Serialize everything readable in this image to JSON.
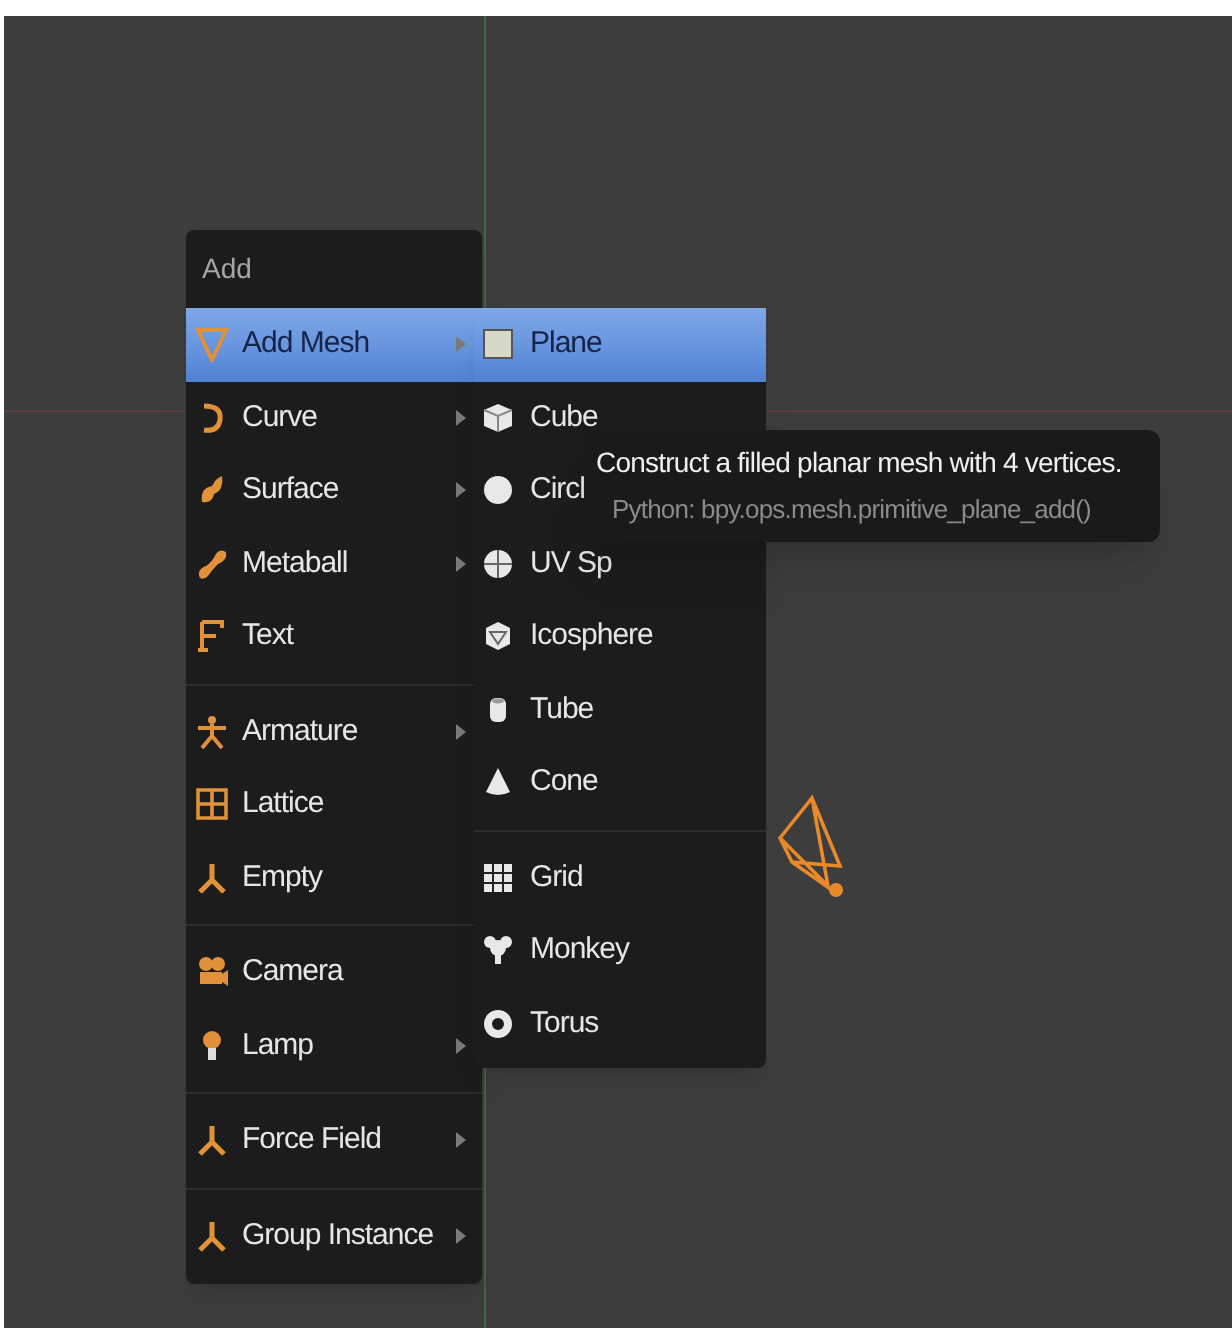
{
  "menu": {
    "title": "Add",
    "sections": [
      [
        {
          "label": "Add Mesh",
          "has_submenu": true,
          "selected": true
        },
        {
          "label": "Curve",
          "has_submenu": true,
          "selected": false
        },
        {
          "label": "Surface",
          "has_submenu": true,
          "selected": false
        },
        {
          "label": "Metaball",
          "has_submenu": true,
          "selected": false
        },
        {
          "label": "Text",
          "has_submenu": false,
          "selected": false
        }
      ],
      [
        {
          "label": "Armature",
          "has_submenu": true,
          "selected": false
        },
        {
          "label": "Lattice",
          "has_submenu": false,
          "selected": false
        },
        {
          "label": "Empty",
          "has_submenu": false,
          "selected": false
        }
      ],
      [
        {
          "label": "Camera",
          "has_submenu": false,
          "selected": false
        },
        {
          "label": "Lamp",
          "has_submenu": true,
          "selected": false
        }
      ],
      [
        {
          "label": "Force Field",
          "has_submenu": true,
          "selected": false
        }
      ],
      [
        {
          "label": "Group Instance",
          "has_submenu": true,
          "selected": false
        }
      ]
    ]
  },
  "submenu": {
    "sections": [
      [
        {
          "label": "Plane",
          "selected": true
        },
        {
          "label": "Cube",
          "selected": false
        },
        {
          "label": "Circl",
          "selected": false
        },
        {
          "label": "UV Sp",
          "selected": false
        },
        {
          "label": "Icosphere",
          "selected": false
        },
        {
          "label": "Tube",
          "selected": false
        },
        {
          "label": "Cone",
          "selected": false
        }
      ],
      [
        {
          "label": "Grid",
          "selected": false
        },
        {
          "label": "Monkey",
          "selected": false
        },
        {
          "label": "Torus",
          "selected": false
        }
      ]
    ]
  },
  "tooltip": {
    "description": "Construct a filled planar mesh with 4 vertices.",
    "python": "Python: bpy.ops.mesh.primitive_plane_add()"
  }
}
